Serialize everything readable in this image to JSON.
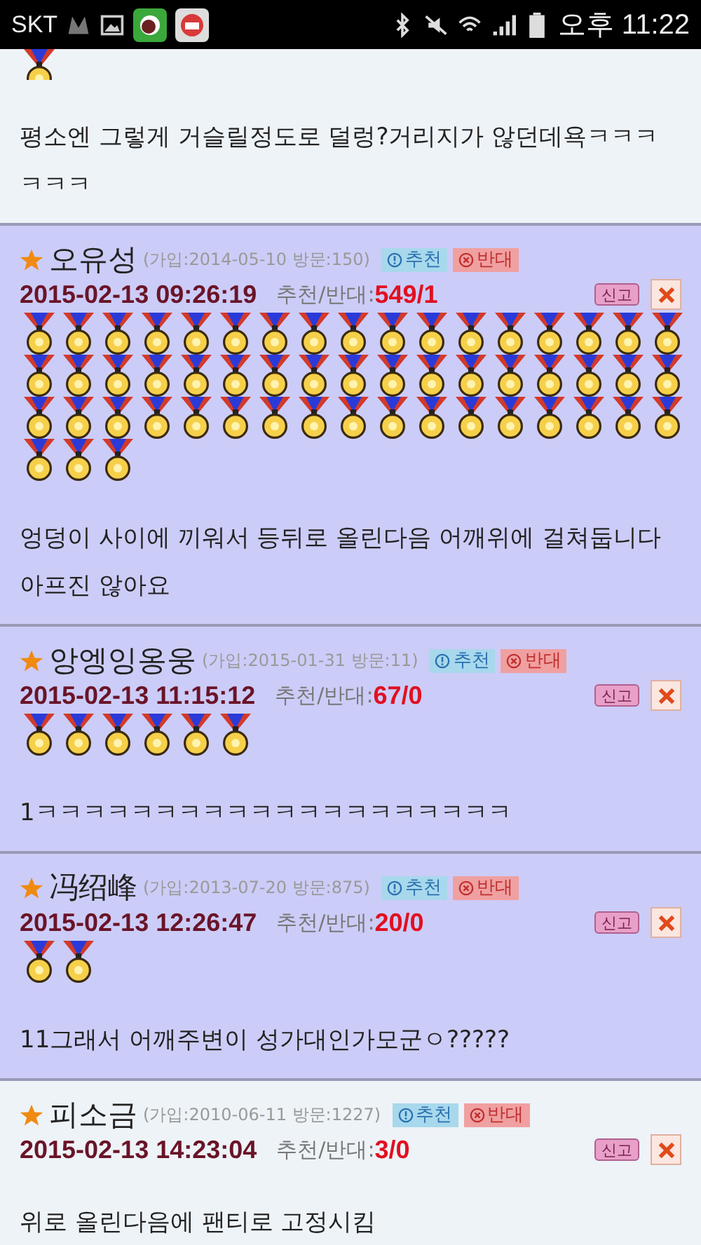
{
  "status_bar": {
    "carrier": "SKT",
    "time": "오후 11:22"
  },
  "comments": [
    {
      "highlighted": false,
      "medals": [
        {
          "kind": "medal"
        }
      ],
      "body": "평소엔 그렇게 거슬릴정도로 덜렁?거리지가 않던데욕ㅋㅋㅋㅋㅋㅋ"
    },
    {
      "highlighted": true,
      "name": "오유성",
      "meta": "(가입:2014-05-10 방문:150)",
      "up_label": "추천",
      "down_label": "반대",
      "datetime": "2015-02-13 09:26:19",
      "votes_label": "추천/반대:",
      "votes": "549/1",
      "report": "신고",
      "medals": [
        {
          "kind": "medal"
        },
        {
          "kind": "medal"
        },
        {
          "kind": "medal"
        },
        {
          "kind": "medal"
        },
        {
          "kind": "medal"
        },
        {
          "kind": "medal"
        },
        {
          "kind": "medal"
        },
        {
          "kind": "medal"
        },
        {
          "kind": "medal"
        },
        {
          "kind": "medal"
        },
        {
          "kind": "medal"
        },
        {
          "kind": "medal"
        },
        {
          "kind": "medal"
        },
        {
          "kind": "medal"
        },
        {
          "kind": "medal"
        },
        {
          "kind": "medal"
        },
        {
          "kind": "medal"
        },
        {
          "kind": "medal"
        },
        {
          "kind": "medal"
        },
        {
          "kind": "medal"
        },
        {
          "kind": "medal"
        },
        {
          "kind": "medal"
        },
        {
          "kind": "medal"
        },
        {
          "kind": "medal"
        },
        {
          "kind": "medal"
        },
        {
          "kind": "medal"
        },
        {
          "kind": "medal"
        },
        {
          "kind": "medal"
        },
        {
          "kind": "medal"
        },
        {
          "kind": "medal"
        },
        {
          "kind": "medal"
        },
        {
          "kind": "medal"
        },
        {
          "kind": "medal"
        },
        {
          "kind": "medal"
        },
        {
          "kind": "medal"
        },
        {
          "kind": "medal"
        },
        {
          "kind": "medal"
        },
        {
          "kind": "medal"
        },
        {
          "kind": "medal"
        },
        {
          "kind": "medal"
        },
        {
          "kind": "medal"
        },
        {
          "kind": "medal"
        },
        {
          "kind": "medal"
        },
        {
          "kind": "medal"
        },
        {
          "kind": "medal"
        },
        {
          "kind": "medal"
        },
        {
          "kind": "medal"
        },
        {
          "kind": "medal"
        },
        {
          "kind": "medal"
        },
        {
          "kind": "medal"
        },
        {
          "kind": "medal"
        },
        {
          "kind": "medal"
        },
        {
          "kind": "medal"
        },
        {
          "kind": "medal"
        }
      ],
      "body": "엉덩이 사이에 끼워서 등뒤로 올린다음 어깨위에 걸쳐둡니다 아프진 않아요"
    },
    {
      "highlighted": true,
      "name": "앙엥잉옹웅",
      "meta": "(가입:2015-01-31 방문:11)",
      "up_label": "추천",
      "down_label": "반대",
      "datetime": "2015-02-13 11:15:12",
      "votes_label": "추천/반대:",
      "votes": "67/0",
      "report": "신고",
      "medals": [
        {
          "kind": "medal"
        },
        {
          "kind": "medal"
        },
        {
          "kind": "medal"
        },
        {
          "kind": "medal"
        },
        {
          "kind": "medal"
        },
        {
          "kind": "medal"
        }
      ],
      "body": "1ㅋㅋㅋㅋㅋㅋㅋㅋㅋㅋㅋㅋㅋㅋㅋㅋㅋㅋㅋㅋ"
    },
    {
      "highlighted": true,
      "name": "冯绍峰",
      "meta": "(가입:2013-07-20 방문:875)",
      "up_label": "추천",
      "down_label": "반대",
      "datetime": "2015-02-13 12:26:47",
      "votes_label": "추천/반대:",
      "votes": "20/0",
      "report": "신고",
      "medals": [
        {
          "kind": "medal"
        },
        {
          "kind": "medal"
        }
      ],
      "body": "11그래서 어깨주변이 성가대인가모군ㅇ?????"
    },
    {
      "highlighted": false,
      "name": "피소금",
      "meta": "(가입:2010-06-11 방문:1227)",
      "up_label": "추천",
      "down_label": "반대",
      "datetime": "2015-02-13 14:23:04",
      "votes_label": "추천/반대:",
      "votes": "3/0",
      "report": "신고",
      "body": "위로 올린다음에 팬티로 고정시킴"
    }
  ]
}
